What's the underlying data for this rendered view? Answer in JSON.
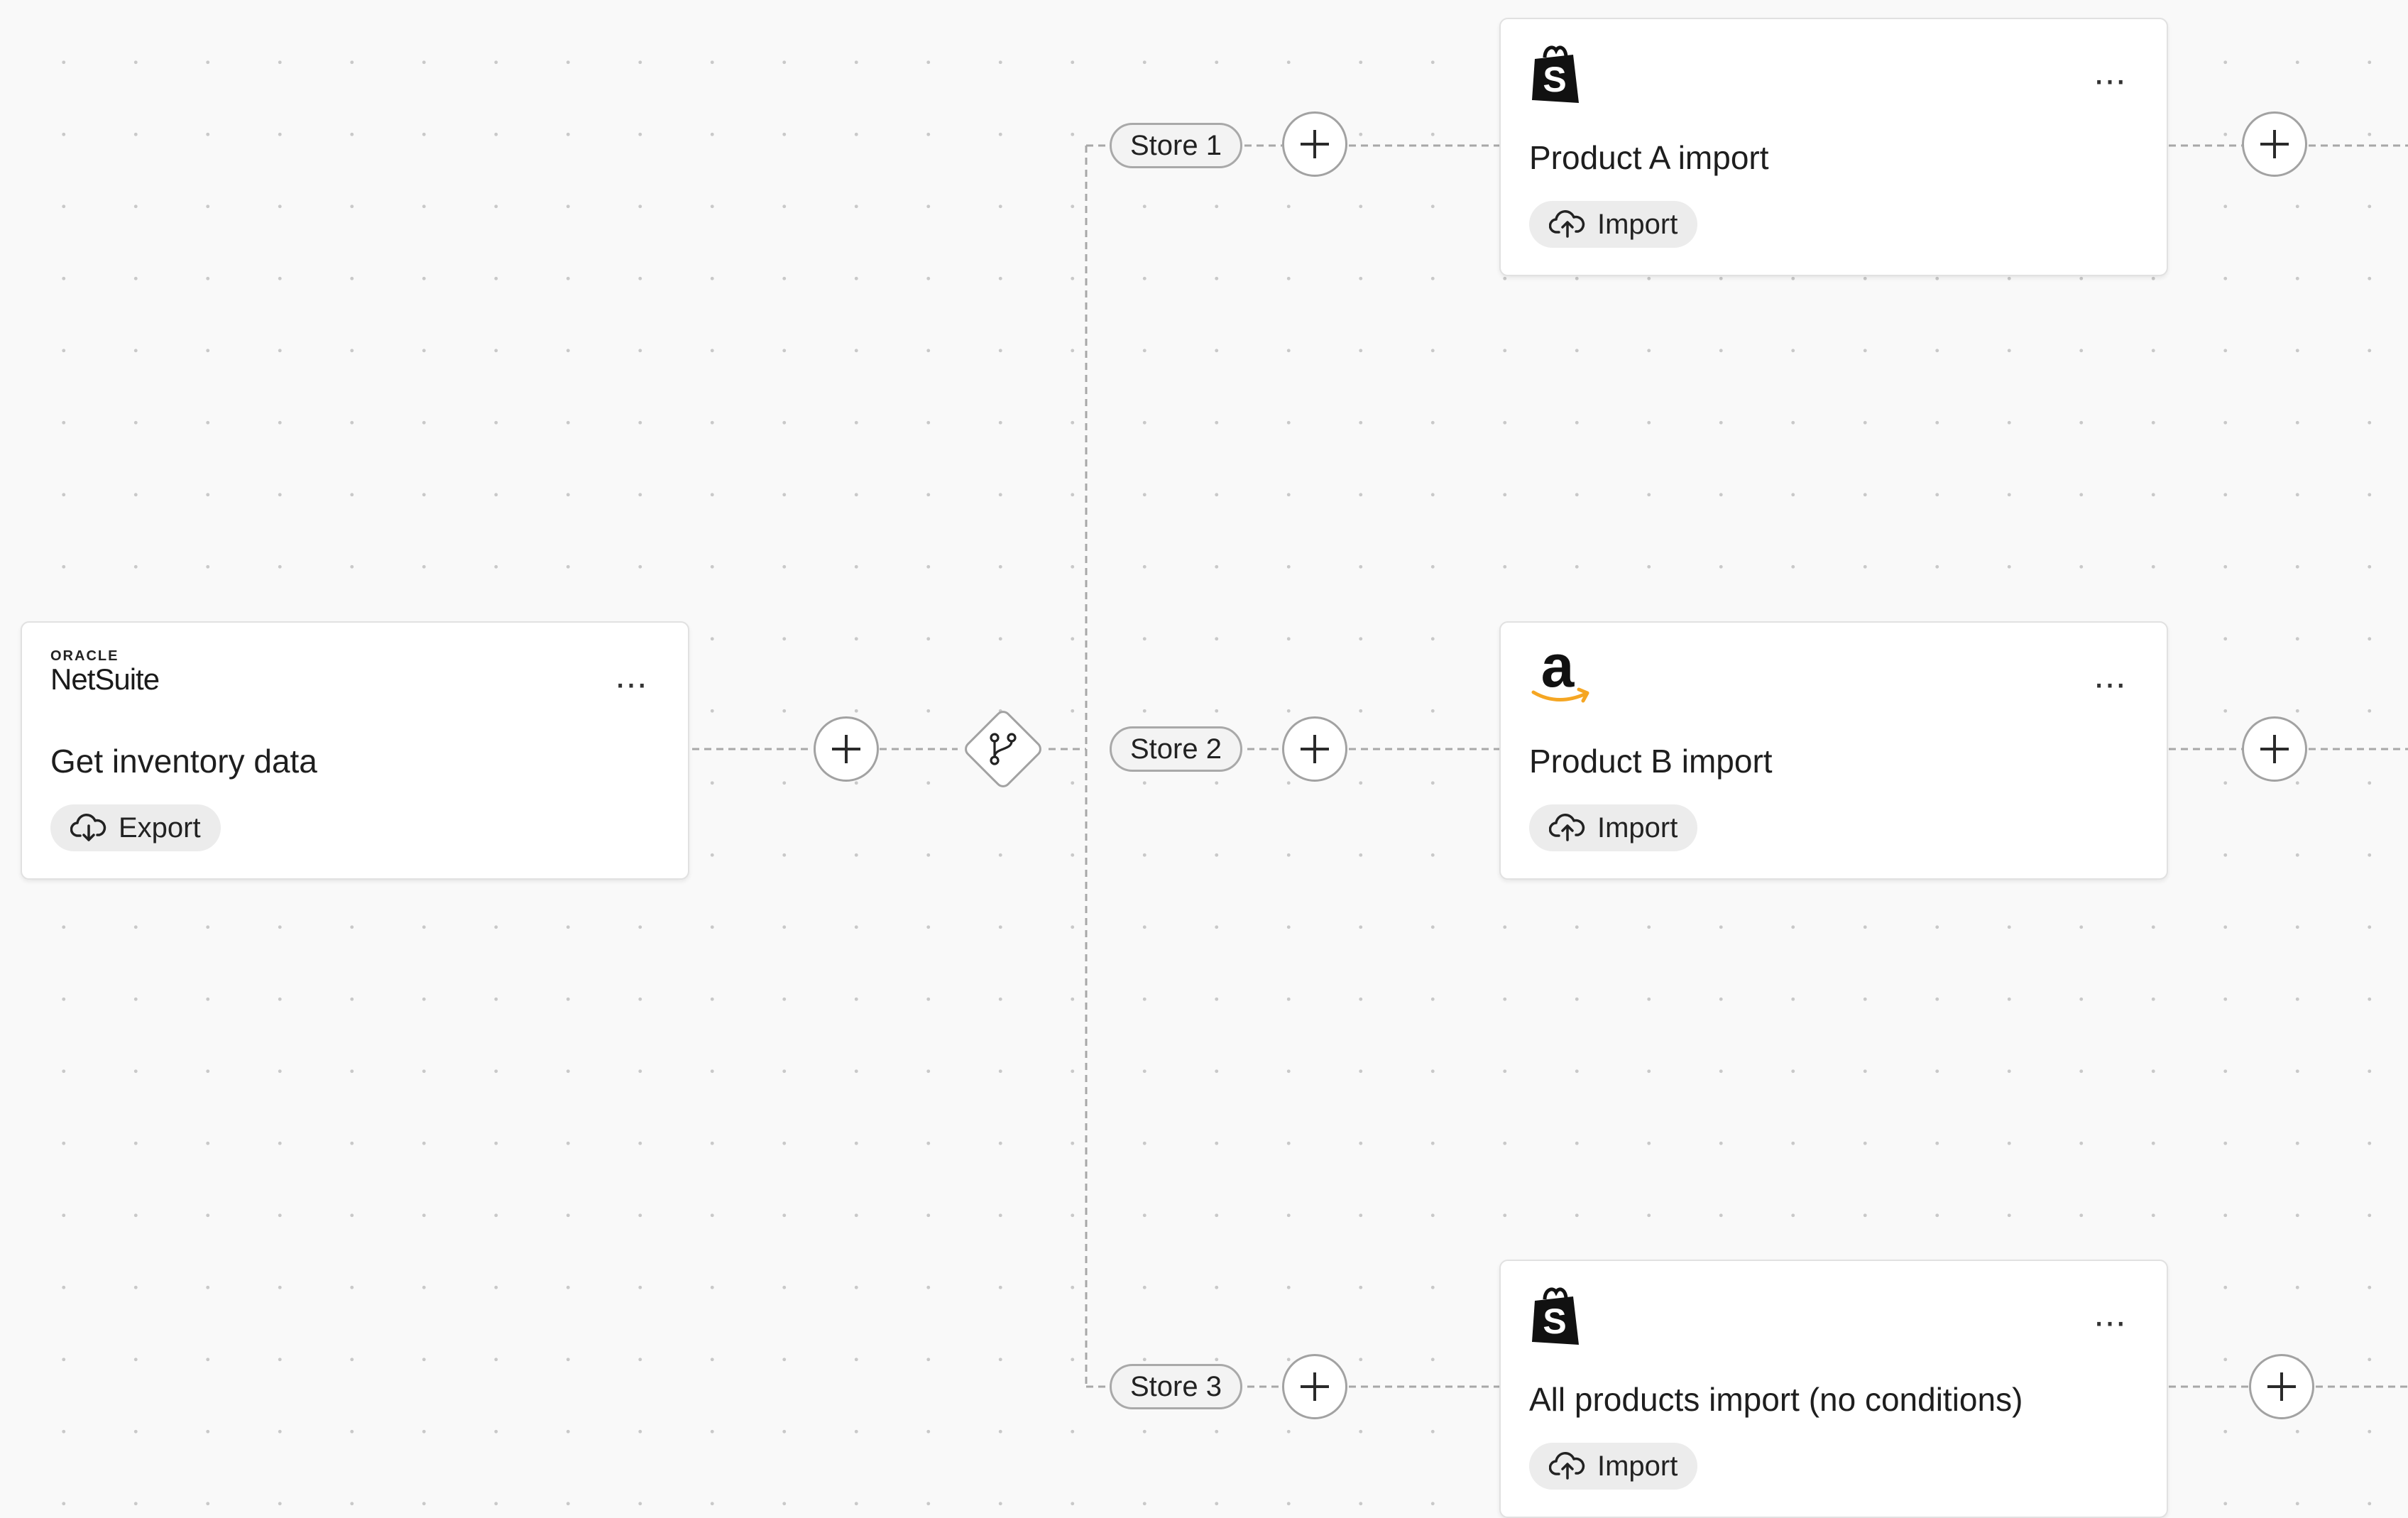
{
  "colors": {
    "canvas_bg": "#f9f9f9",
    "card_bg": "#ffffff",
    "connector": "#a8a8a8",
    "amazon_smile": "#f5a623"
  },
  "source_card": {
    "logo_top": "ORACLE",
    "logo_bottom": "NetSuite",
    "logo_icon": "oracle-netsuite-logo",
    "menu": "···",
    "title": "Get inventory data",
    "badge_label": "Export",
    "badge_icon": "cloud-download-icon"
  },
  "branch_node": {
    "icon": "git-branch-icon"
  },
  "branches": [
    {
      "label": "Store 1",
      "card": {
        "logo_icon": "shopify-bag-icon",
        "menu": "···",
        "title": "Product A import",
        "badge_label": "Import",
        "badge_icon": "cloud-upload-icon"
      }
    },
    {
      "label": "Store 2",
      "card": {
        "logo_icon": "amazon-logo",
        "logo_text": "a",
        "menu": "···",
        "title": "Product B import",
        "badge_label": "Import",
        "badge_icon": "cloud-upload-icon"
      }
    },
    {
      "label": "Store 3",
      "card": {
        "logo_icon": "shopify-bag-icon",
        "menu": "···",
        "title": "All products import (no conditions)",
        "badge_label": "Import",
        "badge_icon": "cloud-upload-icon"
      }
    }
  ]
}
